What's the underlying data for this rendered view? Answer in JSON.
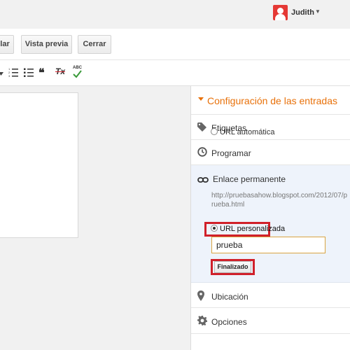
{
  "user": {
    "name": "Judith"
  },
  "actions": {
    "publish_label": "lar",
    "preview_label": "Vista previa",
    "close_label": "Cerrar"
  },
  "toolbar": {
    "quote_glyph": "❝",
    "clear_format_glyph": "Tx",
    "spellcheck_glyph": "ABC"
  },
  "sidebar": {
    "title": "Configuración de las entradas",
    "labels": "Etiquetas",
    "schedule": "Programar",
    "permalink": {
      "label": "Enlace permanente",
      "url": "http://pruebasahow.blogspot.com/2012/07/prueba.html",
      "option_auto": "URL automática",
      "option_custom": "URL personalizada",
      "selected": "URL personalizada",
      "custom_value": "prueba",
      "done_label": "Finalizado"
    },
    "location": "Ubicación",
    "options": "Opciones"
  },
  "colors": {
    "accent": "#e8710a",
    "highlight": "#d0202a",
    "avatar": "#e53935"
  }
}
